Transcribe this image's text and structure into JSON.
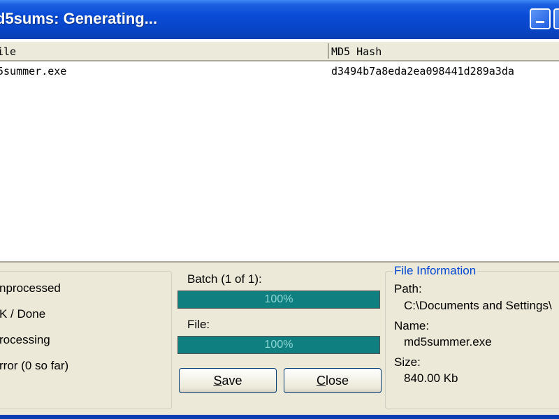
{
  "window": {
    "title": "d5sums: Generating..."
  },
  "list": {
    "columns": [
      "ile",
      "MD5 Hash"
    ],
    "rows": [
      {
        "file": "5summer.exe",
        "hash": "d3494b7a8eda2ea098441d289a3da"
      }
    ]
  },
  "legend": {
    "items": [
      "nprocessed",
      "K / Done",
      "rocessing",
      "rror (0 so far)"
    ]
  },
  "progress": {
    "batch_label": "Batch (1 of 1):",
    "batch_percent_text": "100%",
    "batch_value": 1.0,
    "file_label": "File:",
    "file_percent_text": "100%",
    "file_value": 1.0
  },
  "buttons": {
    "save": "S",
    "save_rest": "ave",
    "close": "C",
    "close_rest": "lose"
  },
  "file_info": {
    "title": "File Information",
    "path_label": "Path:",
    "path_value": "C:\\Documents and Settings\\",
    "name_label": "Name:",
    "name_value": "md5summer.exe",
    "size_label": "Size:",
    "size_value": "840.00 Kb"
  },
  "colors": {
    "titlebar": "#0a4bd6",
    "progress": "#0f7f80",
    "groupbox_title": "#0046d5"
  }
}
